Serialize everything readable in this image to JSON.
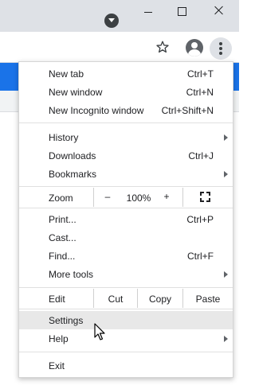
{
  "menu": {
    "group1": [
      {
        "label": "New tab",
        "shortcut": "Ctrl+T"
      },
      {
        "label": "New window",
        "shortcut": "Ctrl+N"
      },
      {
        "label": "New Incognito window",
        "shortcut": "Ctrl+Shift+N"
      }
    ],
    "group2": [
      {
        "label": "History",
        "shortcut": ""
      },
      {
        "label": "Downloads",
        "shortcut": "Ctrl+J"
      },
      {
        "label": "Bookmarks",
        "shortcut": ""
      }
    ],
    "zoom": {
      "label": "Zoom",
      "minus": "–",
      "value": "100%",
      "plus": "+"
    },
    "group3": [
      {
        "label": "Print...",
        "shortcut": "Ctrl+P"
      },
      {
        "label": "Cast...",
        "shortcut": ""
      },
      {
        "label": "Find...",
        "shortcut": "Ctrl+F"
      },
      {
        "label": "More tools",
        "shortcut": ""
      }
    ],
    "edit": {
      "label": "Edit",
      "cut": "Cut",
      "copy": "Copy",
      "paste": "Paste"
    },
    "group4": [
      {
        "label": "Settings",
        "shortcut": ""
      },
      {
        "label": "Help",
        "shortcut": ""
      }
    ],
    "exit": {
      "label": "Exit"
    }
  },
  "icons": {
    "tab_search": "chevron-down-circle-icon",
    "minimize": "minimize-icon",
    "maximize": "maximize-icon",
    "close": "close-icon",
    "bookmark": "star-icon",
    "profile": "profile-icon",
    "menu": "three-dots-vertical-icon",
    "fullscreen": "fullscreen-icon",
    "cursor": "mouse-pointer-icon"
  },
  "colors": {
    "accent_blue": "#1a73e8",
    "titlebar": "#dee1e6",
    "hover": "#e8e8e8"
  }
}
